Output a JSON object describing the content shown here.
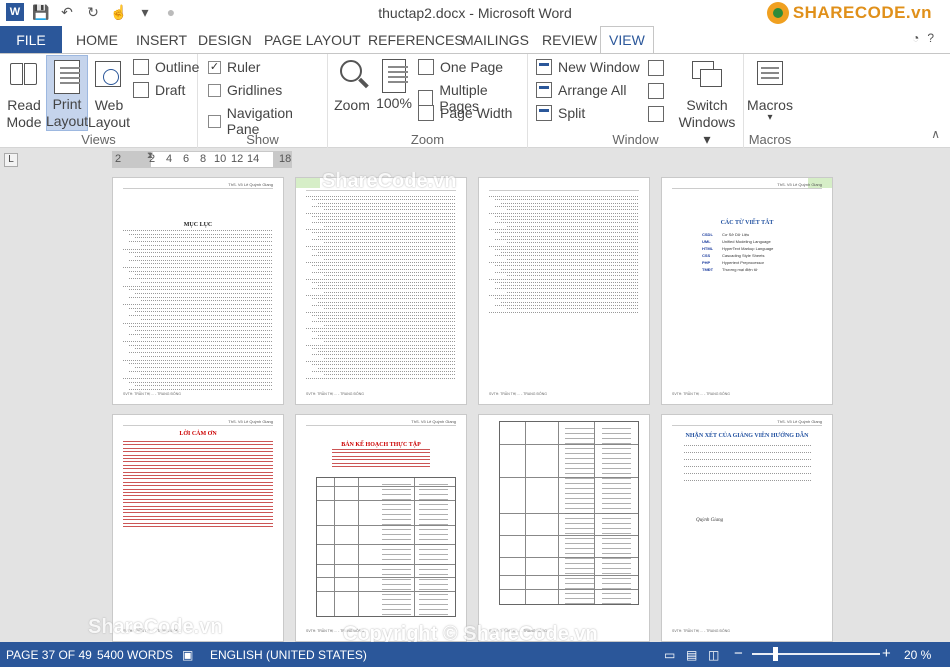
{
  "window": {
    "title": "thuctap2.docx - Microsoft Word",
    "brand_logo_text": "SHARECODE.vn",
    "help_icon": "question-icon",
    "window_buttons": [
      "minimize-icon",
      "restore-icon",
      "close-icon"
    ]
  },
  "quick_access": {
    "icons": [
      "word-app-icon",
      "save-icon",
      "undo-icon",
      "redo-icon",
      "touch-mode-icon",
      "customize-icon"
    ]
  },
  "tabs": {
    "file": "FILE",
    "items": [
      "HOME",
      "INSERT",
      "DESIGN",
      "PAGE LAYOUT",
      "REFERENCES",
      "MAILINGS",
      "REVIEW",
      "VIEW"
    ],
    "active": "VIEW"
  },
  "ribbon": {
    "views": {
      "label": "Views",
      "read_mode": [
        "Read",
        "Mode"
      ],
      "print_layout": [
        "Print",
        "Layout"
      ],
      "web_layout": [
        "Web",
        "Layout"
      ],
      "outline": "Outline",
      "draft": "Draft"
    },
    "show": {
      "label": "Show",
      "ruler": "Ruler",
      "gridlines": "Gridlines",
      "navigation_pane": "Navigation Pane",
      "ruler_checked": true,
      "gridlines_checked": false,
      "navigation_pane_checked": false
    },
    "zoom": {
      "label": "Zoom",
      "zoom": "Zoom",
      "zoom_100": "100%",
      "one_page": "One Page",
      "multiple_pages": "Multiple Pages",
      "page_width": "Page Width"
    },
    "window": {
      "label": "Window",
      "new_window": "New Window",
      "arrange_all": "Arrange All",
      "split": "Split",
      "switch_windows": [
        "Switch",
        "Windows"
      ]
    },
    "macros": {
      "label": "Macros",
      "macros": "Macros"
    }
  },
  "ruler": {
    "numbers": [
      "2",
      "2",
      "4",
      "6",
      "8",
      "10",
      "12",
      "14",
      "18"
    ]
  },
  "pages": {
    "header_name": "ThS. Võ Lê Quỳnh Giang",
    "footer": "SVTH: TRẦN THỊ ... - TRANG ĐÔNG",
    "toc_title": "MỤC LỤC",
    "glossary_title": "CÁC TỪ VIẾT TẮT",
    "glossary": [
      {
        "abbr": "CSDL",
        "full": "Cơ Sở Dữ Liệu"
      },
      {
        "abbr": "UML",
        "full": "Unified Modeling Language"
      },
      {
        "abbr": "HTML",
        "full": "HyperText Markup Language"
      },
      {
        "abbr": "CSS",
        "full": "Cascading Style Sheets"
      },
      {
        "abbr": "PHP",
        "full": "Hypertext Preprocessor"
      },
      {
        "abbr": "TMĐT",
        "full": "Thương mại điện tử"
      }
    ],
    "thanks_title": "LỜI CẢM ƠN",
    "plan_title": "BẢN KẾ HOẠCH THỰC TẬP",
    "review_title": "NHẬN XÉT CỦA GIẢNG VIÊN HƯỚNG DẪN",
    "signature": "Quỳnh Giang"
  },
  "watermark": {
    "text1": "ShareCode.vn",
    "text2": "Copyright © ShareCode.vn"
  },
  "status": {
    "page": "PAGE 37 OF 49",
    "words": "5400 WORDS",
    "language": "ENGLISH (UNITED STATES)",
    "zoom_minus": "−",
    "zoom_plus": "+",
    "zoom_level": "20 %",
    "zoom_percent": 20
  }
}
